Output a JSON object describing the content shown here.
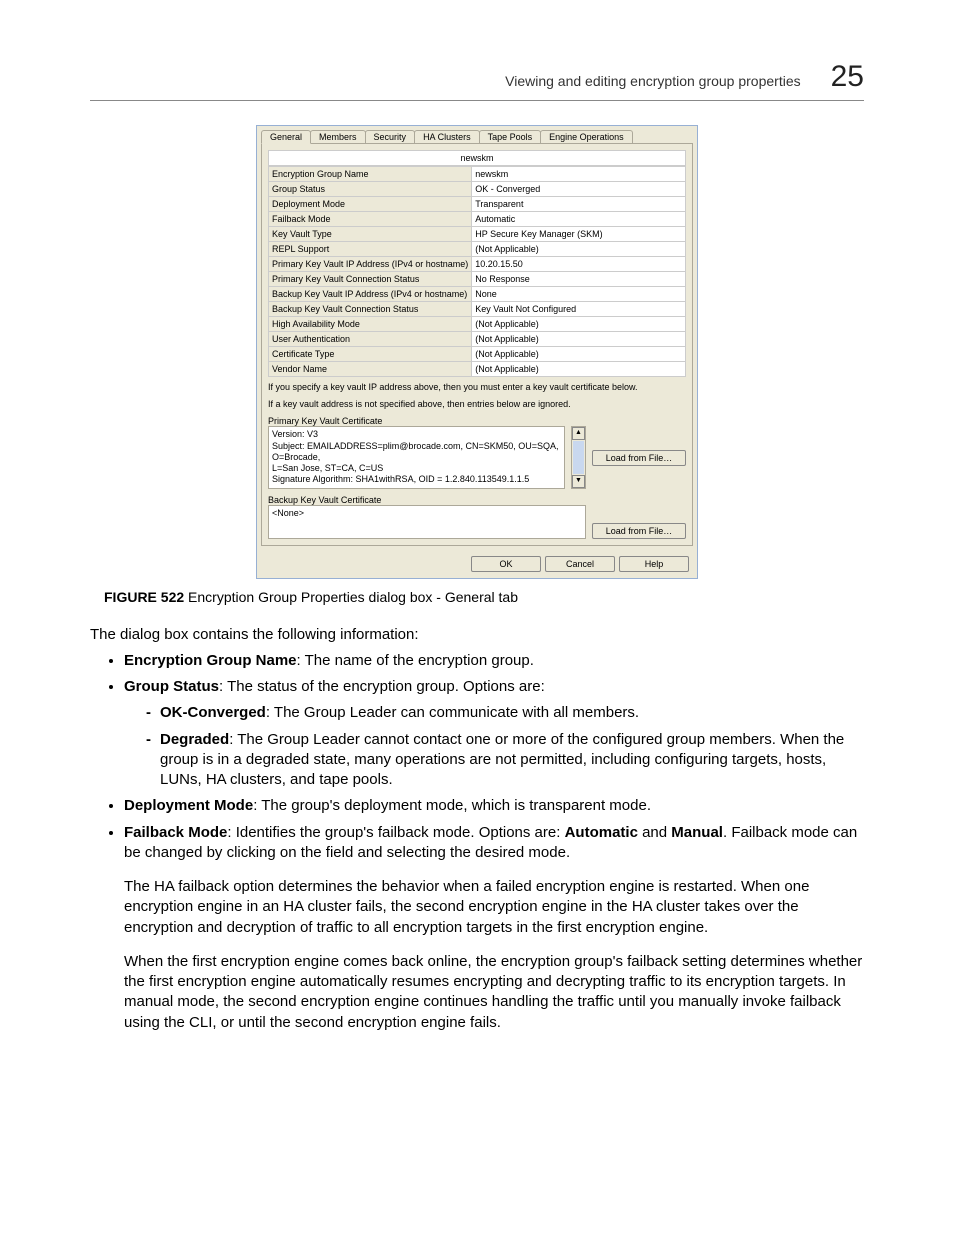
{
  "header": {
    "title": "Viewing and editing encryption group properties",
    "chapter": "25"
  },
  "dialog": {
    "tabs": [
      "General",
      "Members",
      "Security",
      "HA Clusters",
      "Tape Pools",
      "Engine Operations"
    ],
    "selected_tab": "General",
    "group_title": "newskm",
    "rows": [
      {
        "label": "Encryption Group Name",
        "value": "newskm"
      },
      {
        "label": "Group Status",
        "value": "OK - Converged"
      },
      {
        "label": "Deployment Mode",
        "value": "Transparent"
      },
      {
        "label": "Failback Mode",
        "value": "Automatic"
      },
      {
        "label": "Key Vault Type",
        "value": "HP Secure Key Manager (SKM)"
      },
      {
        "label": "REPL Support",
        "value": "(Not Applicable)"
      },
      {
        "label": "Primary Key Vault IP Address (IPv4 or hostname)",
        "value": "10.20.15.50"
      },
      {
        "label": "Primary Key Vault Connection Status",
        "value": "No Response"
      },
      {
        "label": "Backup Key Vault IP Address (IPv4 or hostname)",
        "value": "None"
      },
      {
        "label": "Backup Key Vault Connection Status",
        "value": "Key Vault Not Configured"
      },
      {
        "label": "High Availability Mode",
        "value": "(Not Applicable)"
      },
      {
        "label": "User Authentication",
        "value": "(Not Applicable)"
      },
      {
        "label": "Certificate Type",
        "value": "(Not Applicable)"
      },
      {
        "label": "Vendor Name",
        "value": "(Not Applicable)"
      }
    ],
    "note1": "If you specify a key vault IP address above, then you must enter a key vault certificate below.",
    "note2": "If a key vault address is not specified above, then entries below are ignored.",
    "primary_cert_label": "Primary Key Vault Certificate",
    "primary_cert_lines": [
      "Version: V3",
      "Subject: EMAILADDRESS=plim@brocade.com, CN=SKM50, OU=SQA, O=Brocade,",
      "L=San Jose, ST=CA, C=US",
      "Signature Algorithm: SHA1withRSA, OID = 1.2.840.113549.1.1.5"
    ],
    "backup_cert_label": "Backup Key Vault Certificate",
    "backup_cert_content": "<None>",
    "load_button": "Load from File…",
    "buttons": {
      "ok": "OK",
      "cancel": "Cancel",
      "help": "Help"
    }
  },
  "figure": {
    "label": "FIGURE 522",
    "caption": "Encryption Group Properties dialog box - General tab"
  },
  "body": {
    "intro": "The dialog box contains the following information:",
    "b1_lead": "Encryption Group Name",
    "b1_text": ": The name of the encryption group.",
    "b2_lead": "Group Status",
    "b2_text": ": The status of the encryption group. Options are:",
    "b2a_lead": "OK-Converged",
    "b2a_text": ": The Group Leader can communicate with all members.",
    "b2b_lead": "Degraded",
    "b2b_text": ": The Group Leader cannot contact one or more of the configured group members. When the group is in a degraded state, many operations are not permitted, including configuring targets, hosts, LUNs, HA clusters, and tape pools.",
    "b3_lead": "Deployment Mode",
    "b3_text": ": The group's deployment mode, which is transparent mode.",
    "b4_lead": "Failback Mode",
    "b4_text_a": ": Identifies the group's failback mode. Options are: ",
    "b4_auto": "Automatic",
    "b4_and": " and ",
    "b4_manual": "Manual",
    "b4_text_b": ". Failback mode can be changed by clicking on the field and selecting the desired mode.",
    "b4_para1": "The HA failback option determines the behavior when a failed encryption engine is restarted. When one encryption engine in an HA cluster fails, the second encryption engine in the HA cluster takes over the encryption and decryption of traffic to all encryption targets in the first encryption engine.",
    "b4_para2": "When the first encryption engine comes back online, the encryption group's failback setting determines whether the first encryption engine automatically resumes encrypting and decrypting traffic to its encryption targets. In manual mode, the second encryption engine continues handling the traffic until you manually invoke failback using the CLI, or until the second encryption engine fails."
  }
}
